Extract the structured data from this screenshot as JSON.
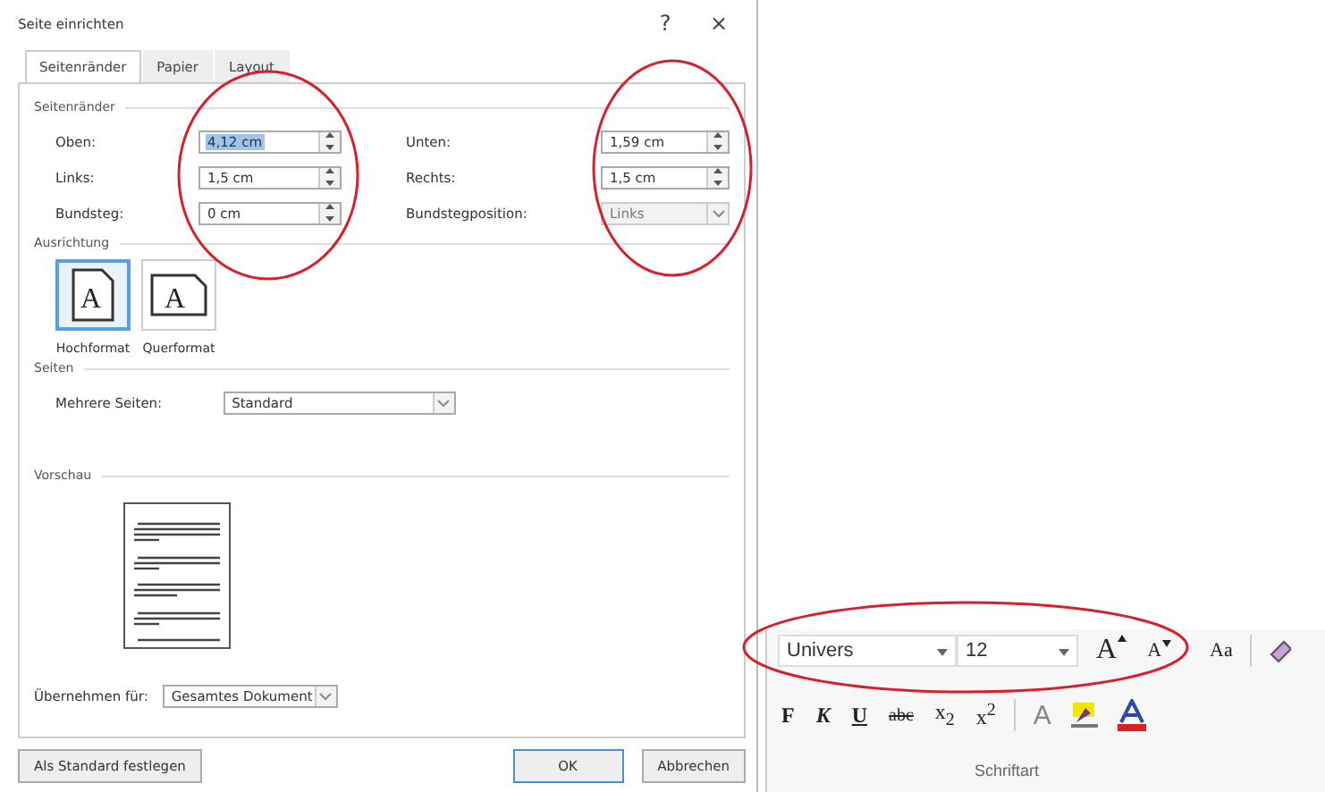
{
  "window": {
    "title": "Seite einrichten",
    "help": "?",
    "close": "×"
  },
  "tabs": [
    {
      "label": "Seitenränder",
      "selected": true
    },
    {
      "label": "Papier",
      "selected": false
    },
    {
      "label": "Layout",
      "selected": false
    }
  ],
  "margins": {
    "heading": "Seitenränder",
    "fields": [
      {
        "label": "Oben:",
        "value": "4,12 cm",
        "kind": "spin",
        "selected": true,
        "disabled": false
      },
      {
        "label": "Unten:",
        "value": "1,59 cm",
        "kind": "spin",
        "selected": false,
        "disabled": false
      },
      {
        "label": "Links:",
        "value": "1,5 cm",
        "kind": "spin",
        "selected": false,
        "disabled": false
      },
      {
        "label": "Rechts:",
        "value": "1,5 cm",
        "kind": "spin",
        "selected": false,
        "disabled": false
      },
      {
        "label": "Bundsteg:",
        "value": "0 cm",
        "kind": "spin",
        "selected": false,
        "disabled": false
      },
      {
        "label": "Bundstegposition:",
        "value": "Links",
        "kind": "dropdown",
        "selected": false,
        "disabled": true
      }
    ]
  },
  "orientation": {
    "heading": "Ausrichtung",
    "options": [
      {
        "label": "Hochformat",
        "glyph": "A",
        "kind": "portrait",
        "selected": true
      },
      {
        "label": "Querformat",
        "glyph": "A",
        "kind": "landscape",
        "selected": false
      }
    ]
  },
  "pages": {
    "heading": "Seiten",
    "label": "Mehrere Seiten:",
    "value": "Standard"
  },
  "preview": {
    "heading": "Vorschau"
  },
  "apply": {
    "label": "Übernehmen für:",
    "value": "Gesamtes Dokument"
  },
  "buttons": [
    {
      "label": "Als Standard festlegen",
      "kind": "left"
    },
    {
      "label": "OK",
      "kind": "default"
    },
    {
      "label": "Abbrechen",
      "kind": "normal"
    }
  ],
  "ribbon": {
    "font": "Univers",
    "size": "12",
    "grow_button": "A",
    "shrink_button": "A",
    "case_button": "Aa",
    "effects_button": "A",
    "format_buttons": [
      {
        "label": "F",
        "kind": "bold"
      },
      {
        "label": "K",
        "kind": "italic"
      },
      {
        "label": "U",
        "kind": "underline"
      },
      {
        "label": "abc",
        "kind": "strike"
      },
      {
        "label": "x$_{2}$",
        "kind": "plain"
      },
      {
        "label": "x$^{2}$",
        "kind": "plain"
      }
    ],
    "group_label": "Schriftart"
  }
}
